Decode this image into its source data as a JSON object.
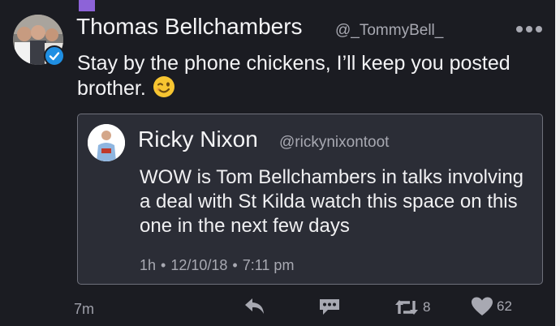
{
  "tweet": {
    "author_name": "Thomas Bellchambers",
    "author_handle": "@_TommyBell_",
    "text": "Stay by the phone chickens, I’ll keep you posted brother.",
    "time_ago": "7m",
    "retweet_count": "8",
    "like_count": "62"
  },
  "quoted_tweet": {
    "author_name": "Ricky Nixon",
    "author_handle": "@rickynixontoot",
    "text": "WOW is Tom Bellchambers in talks involving a deal with St Kilda watch this space on this one in the next few days",
    "time_ago": "1h",
    "date": "12/10/18",
    "time": "7:11 pm"
  },
  "icons": {
    "more": "more-dots-icon",
    "verified": "verified-badge-icon",
    "emoji": "winking-face-emoji",
    "reply": "reply-icon",
    "dm": "direct-message-icon",
    "retweet": "retweet-icon",
    "like": "heart-icon"
  },
  "colors": {
    "background": "#1b1c22",
    "card_background": "#2b2d36",
    "card_border": "#6f717b",
    "secondary_text": "#a8a9b2",
    "verified_blue": "#1f8fe3",
    "accent_purple": "#8d63d8"
  },
  "separator": "•"
}
